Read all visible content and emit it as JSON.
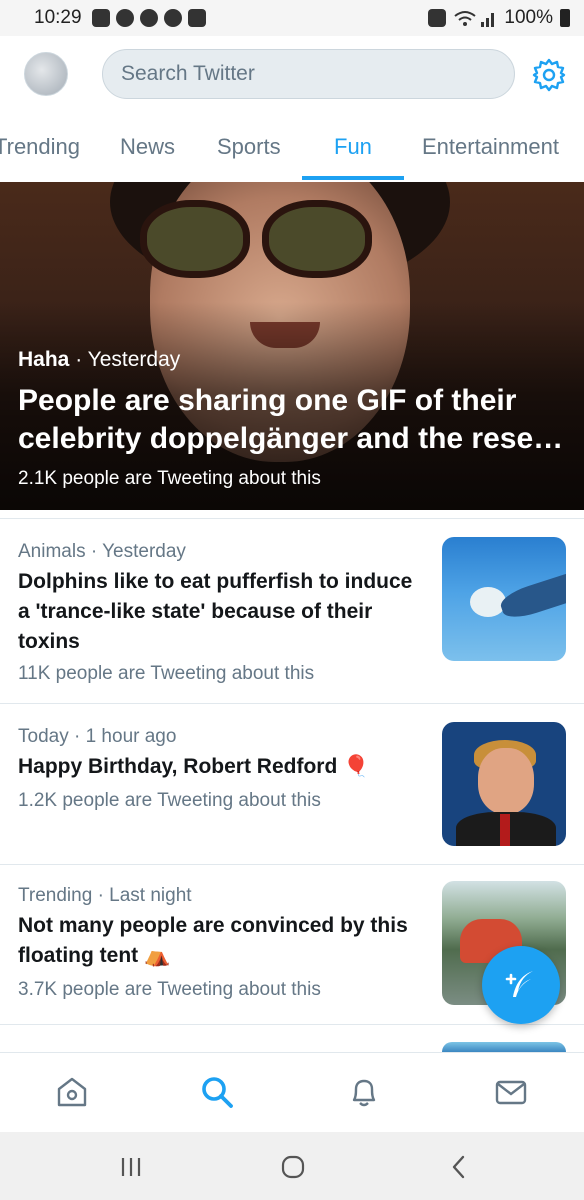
{
  "status_bar": {
    "time": "10:29",
    "battery": "100%"
  },
  "header": {
    "search_placeholder": "Search Twitter"
  },
  "tabs": [
    {
      "label": "Trending"
    },
    {
      "label": "News"
    },
    {
      "label": "Sports"
    },
    {
      "label": "Fun"
    },
    {
      "label": "Entertainment"
    }
  ],
  "active_tab": "Fun",
  "hero": {
    "category": "Haha",
    "time": " · Yesterday",
    "title": "People are sharing one GIF of their celebrity doppelgänger and the rese…",
    "count": "2.1K people are Tweeting about this"
  },
  "feed": [
    {
      "meta": "Animals · Yesterday",
      "headline": "Dolphins like to eat pufferfish to induce a 'trance-like state' because of their toxins",
      "count": "11K people are Tweeting about this",
      "thumb_icon": "dolphin-photo"
    },
    {
      "meta": "Today · 1 hour ago",
      "headline": "Happy Birthday, Robert Redford 🎈",
      "count": "1.2K people are Tweeting about this",
      "thumb_icon": "robert-redford-photo"
    },
    {
      "meta": "Trending · Last night",
      "headline": "Not many people are convinced by this floating tent ⛺",
      "count": "3.7K people are Tweeting about this",
      "thumb_icon": "floating-tent-photo"
    }
  ],
  "colors": {
    "accent": "#1da1f2",
    "text_primary": "#14171a",
    "text_secondary": "#657786"
  },
  "bottom_nav": [
    "home-icon",
    "search-icon",
    "notifications-bell-icon",
    "messages-envelope-icon"
  ],
  "system_nav": [
    "recent-apps-icon",
    "home-button-icon",
    "back-icon"
  ]
}
